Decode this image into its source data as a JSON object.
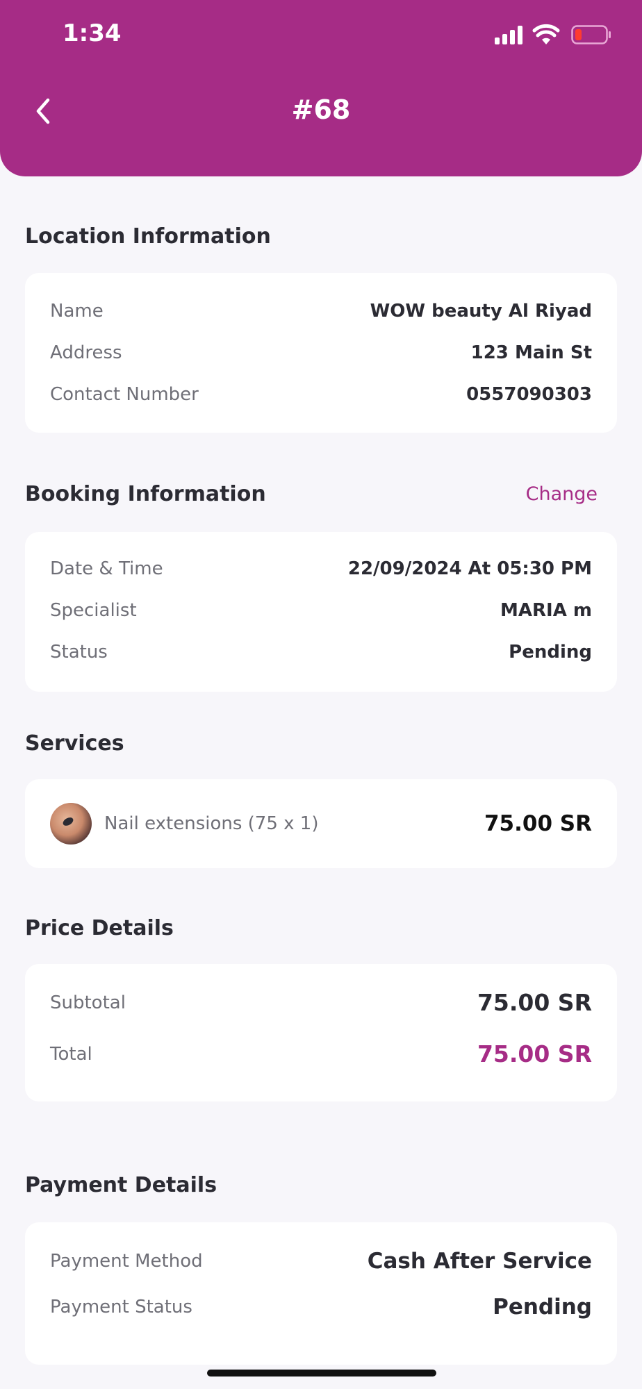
{
  "status_bar": {
    "time": "1:34",
    "icons": [
      "cellular-signal-icon",
      "wifi-icon",
      "battery-low-icon"
    ]
  },
  "header": {
    "title": "#68",
    "back_icon": "chevron-left-icon"
  },
  "colors": {
    "brand": "#a62c86",
    "background": "#f7f6fa",
    "card": "#ffffff",
    "battery_low": "#ff3b30"
  },
  "location": {
    "title": "Location Information",
    "rows": [
      {
        "label": "Name",
        "value": "WOW beauty Al Riyad"
      },
      {
        "label": "Address",
        "value": "123 Main St"
      },
      {
        "label": "Contact Number",
        "value": "0557090303"
      }
    ]
  },
  "booking": {
    "title": "Booking Information",
    "change_label": "Change",
    "rows": [
      {
        "label": "Date & Time",
        "value": "22/09/2024 At 05:30 PM"
      },
      {
        "label": "Specialist",
        "value": "MARIA m"
      },
      {
        "label": "Status",
        "value": "Pending"
      }
    ]
  },
  "services": {
    "title": "Services",
    "items": [
      {
        "name": "Nail extensions (75 x 1)",
        "price": "75.00 SR"
      }
    ]
  },
  "price_details": {
    "title": "Price Details",
    "subtotal_label": "Subtotal",
    "subtotal_value": "75.00 SR",
    "total_label": "Total",
    "total_value": "75.00 SR"
  },
  "payment": {
    "title": "Payment Details",
    "method_label": "Payment Method",
    "method_value": "Cash After Service",
    "status_label": "Payment Status",
    "status_value": "Pending"
  }
}
